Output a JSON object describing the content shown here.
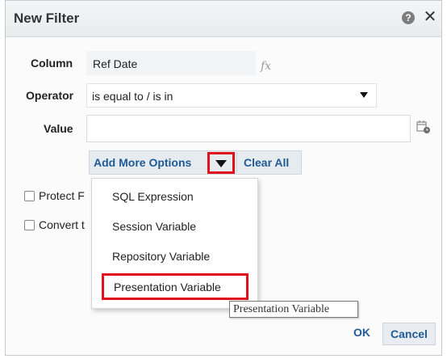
{
  "dialog": {
    "title": "New Filter",
    "help_icon": "question-circle-icon",
    "close_icon": "close-icon"
  },
  "form": {
    "column_label": "Column",
    "column_value": "Ref Date",
    "fx_glyph": "fx",
    "operator_label": "Operator",
    "operator_value": "is equal to / is in",
    "value_label": "Value",
    "value_value": ""
  },
  "buttons": {
    "add_more_options": "Add More Options",
    "clear_all": "Clear All",
    "ok": "OK",
    "cancel": "Cancel"
  },
  "checkboxes": [
    {
      "label": "Protect F",
      "checked": false
    },
    {
      "label": "Convert t",
      "checked": false
    }
  ],
  "menu": {
    "items": [
      {
        "label": "SQL Expression"
      },
      {
        "label": "Session Variable"
      },
      {
        "label": "Repository Variable"
      },
      {
        "label": "Presentation Variable",
        "highlighted": true
      }
    ]
  },
  "tooltip": {
    "text": "Presentation Variable"
  },
  "colors": {
    "accent_link": "#1f5a96",
    "highlight_red": "#e0111a"
  }
}
